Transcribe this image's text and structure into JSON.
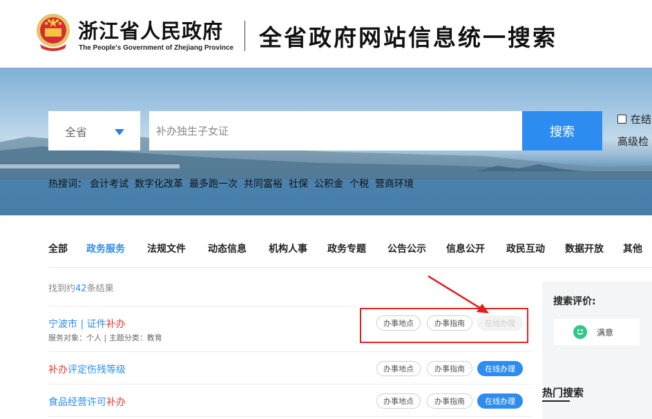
{
  "header": {
    "org_name_cn": "浙江省人民政府",
    "org_name_en": "The People's Government of Zhejiang Province",
    "site_title": "全省政府网站信息统一搜索"
  },
  "search": {
    "scope": "全省",
    "query": "补办独生子女证",
    "button_label": "搜索",
    "in_results_label": "在结",
    "advanced_label": "高级检"
  },
  "hot_words": {
    "label": "热搜词：",
    "items": [
      "会计考试",
      "数字化改革",
      "最多跑一次",
      "共同富裕",
      "社保",
      "公积金",
      "个税",
      "营商环境"
    ]
  },
  "tabs": [
    {
      "label": "全部",
      "active": false
    },
    {
      "label": "政务服务",
      "active": true
    },
    {
      "label": "法规文件",
      "active": false
    },
    {
      "label": "动态信息",
      "active": false
    },
    {
      "label": "机构人事",
      "active": false
    },
    {
      "label": "政务专题",
      "active": false
    },
    {
      "label": "公告公示",
      "active": false
    },
    {
      "label": "信息公开",
      "active": false
    },
    {
      "label": "政民互动",
      "active": false
    },
    {
      "label": "数据开放",
      "active": false
    },
    {
      "label": "其他",
      "active": false
    }
  ],
  "results": {
    "count_prefix": "找到约",
    "count": "42",
    "count_suffix": "条结果",
    "items": [
      {
        "title_plain": "宁波市 | 证件",
        "title_highlight": "补办",
        "meta": "服务对象：个人  |  主题分类：教育",
        "actions": [
          "办事地点",
          "办事指南",
          "在线办理"
        ]
      },
      {
        "title_highlight": "补办",
        "title_plain": "评定伤残等级",
        "actions": [
          "办事地点",
          "办事指南",
          "在线办理"
        ]
      },
      {
        "title_plain": "食品经营许可",
        "title_highlight": "补办",
        "actions": [
          "办事地点",
          "办事指南",
          "在线办理"
        ]
      }
    ]
  },
  "sidebar": {
    "eval_title": "搜索评价:",
    "satisfied_label": "满意",
    "hot_search_title": "热门搜索"
  },
  "colors": {
    "accent": "#2d8cf0",
    "highlight": "#e53935",
    "annotation": "#e02020"
  }
}
